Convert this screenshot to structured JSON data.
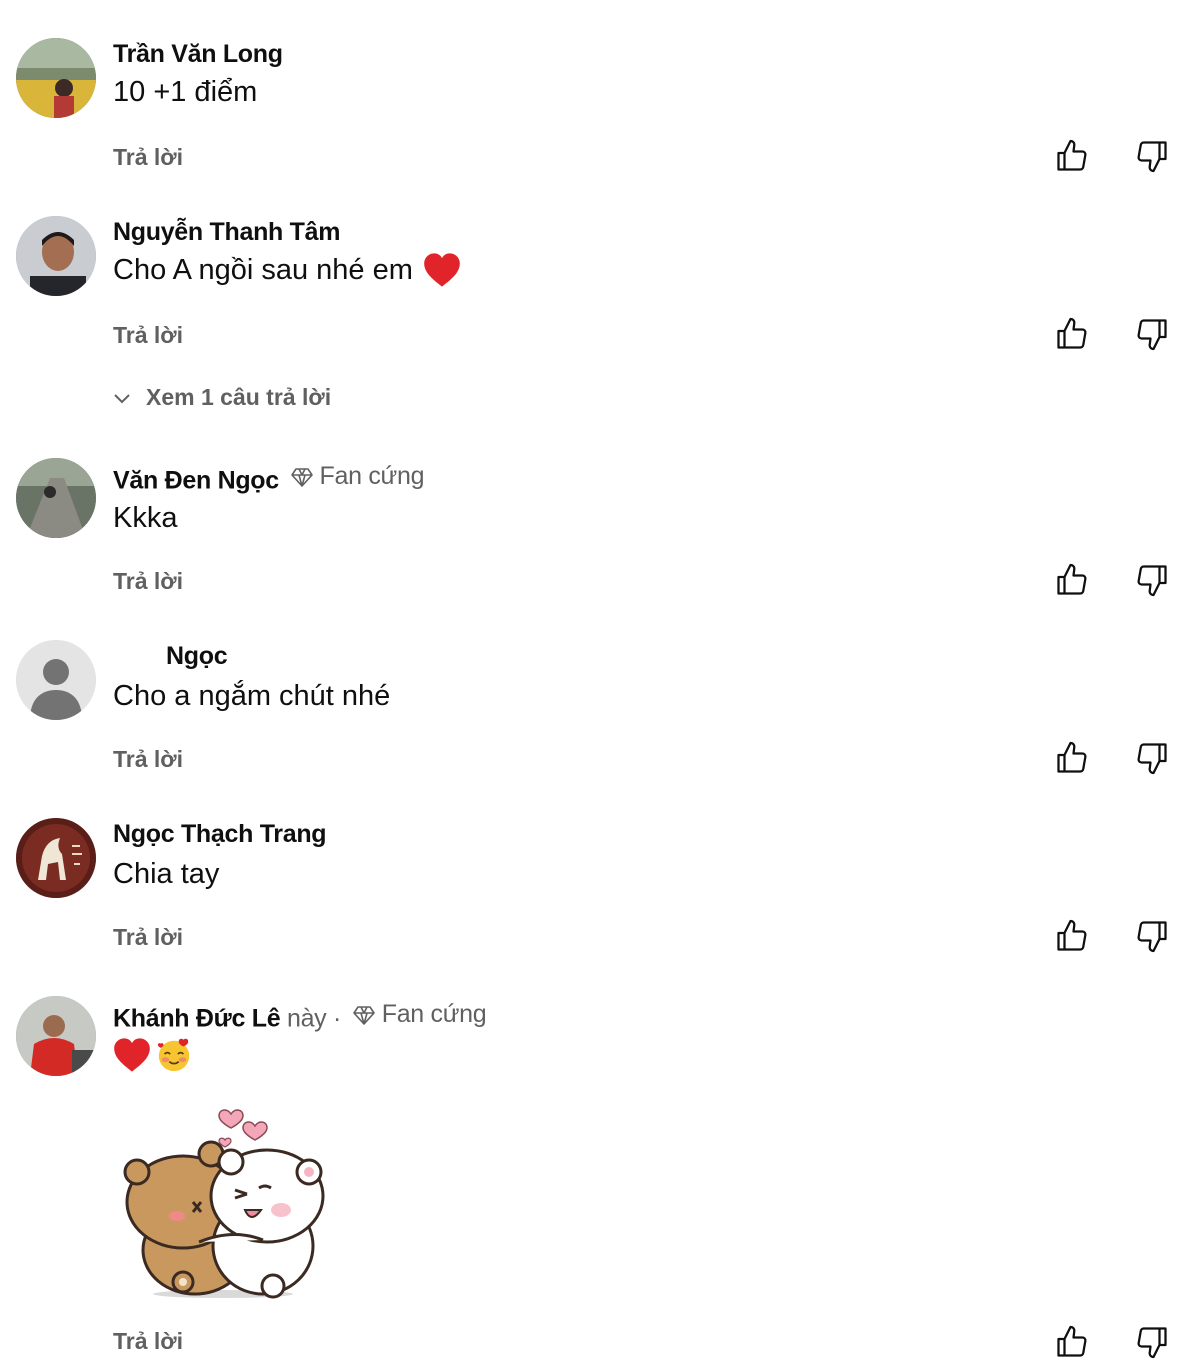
{
  "comments": [
    {
      "author": "Trần Văn Long",
      "text": "10 +1 điểm",
      "reply_label": "Trả lời"
    },
    {
      "author": "Nguyễn Thanh Tâm",
      "text": "Cho A ngồi sau nhé em",
      "reply_label": "Trả lời",
      "view_replies": "Xem 1 câu trả lời"
    },
    {
      "author": "Văn Đen Ngọc",
      "badge": "Fan cứng",
      "text": "Kkka",
      "reply_label": "Trả lời"
    },
    {
      "author": "Ngọc",
      "text": "Cho a ngắm chút nhé",
      "reply_label": "Trả lời"
    },
    {
      "author": "Ngọc Thạch Trang",
      "text": "Chia tay",
      "reply_label": "Trả lời"
    },
    {
      "author": "Khánh Đức Lê",
      "meta": "này ·",
      "badge": "Fan cứng",
      "text": "",
      "reply_label": "Trả lời"
    }
  ],
  "icons": {
    "like": "thumbs-up-icon",
    "dislike": "thumbs-down-icon",
    "badge": "diamond-icon",
    "expand": "chevron-down-icon"
  },
  "colors": {
    "text_primary": "#0f0f0f",
    "text_secondary": "#606060",
    "heart": "#e0242a"
  }
}
